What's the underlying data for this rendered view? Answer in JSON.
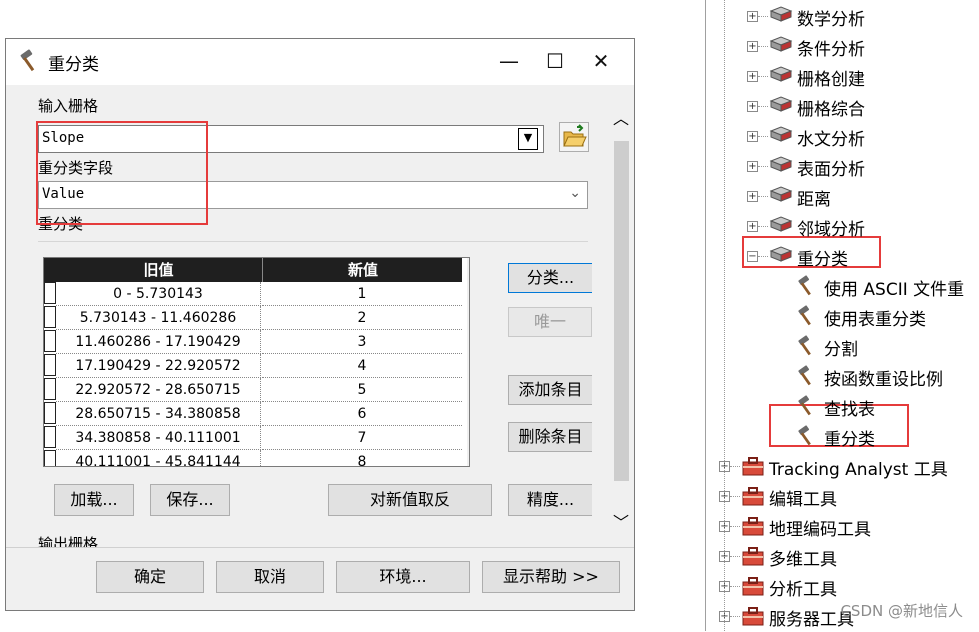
{
  "dialog": {
    "title": "重分类",
    "input_raster_label": "输入栅格",
    "input_raster_value": "Slope",
    "field_label": "重分类字段",
    "field_value": "Value",
    "reclass_label": "重分类",
    "table_headers": [
      "旧值",
      "新值"
    ],
    "rows": [
      {
        "old": "0 - 5.730143",
        "new": "1"
      },
      {
        "old": "5.730143 - 11.460286",
        "new": "2"
      },
      {
        "old": "11.460286 - 17.190429",
        "new": "3"
      },
      {
        "old": "17.190429 - 22.920572",
        "new": "4"
      },
      {
        "old": "22.920572 - 28.650715",
        "new": "5"
      },
      {
        "old": "28.650715 - 34.380858",
        "new": "6"
      },
      {
        "old": "34.380858 - 40.111001",
        "new": "7"
      },
      {
        "old": "40.111001 - 45.841144",
        "new": "8"
      }
    ],
    "side_buttons": {
      "classify": "分类...",
      "unique": "唯一",
      "add_entry": "添加条目",
      "delete_entry": "删除条目"
    },
    "bottom_buttons": {
      "load": "加载...",
      "save": "保存...",
      "reverse": "对新值取反",
      "precision": "精度..."
    },
    "output_raster_label": "输出栅格",
    "footer": {
      "ok": "确定",
      "cancel": "取消",
      "env": "环境...",
      "help": "显示帮助 >>"
    }
  },
  "tree": {
    "spatial_items": [
      "数学分析",
      "条件分析",
      "栅格创建",
      "栅格综合",
      "水文分析",
      "表面分析",
      "距离",
      "邻域分析",
      "重分类"
    ],
    "reclass_children": [
      "使用 ASCII 文件重",
      "使用表重分类",
      "分割",
      "按函数重设比例",
      "查找表",
      "重分类"
    ],
    "toolboxes": [
      "Tracking Analyst 工具",
      "编辑工具",
      "地理编码工具",
      "多维工具",
      "分析工具",
      "服务器工具"
    ]
  },
  "watermark": "CSDN @新地信人",
  "colors": {
    "highlight": "#e53b3b",
    "header": "#1f1f1f"
  }
}
